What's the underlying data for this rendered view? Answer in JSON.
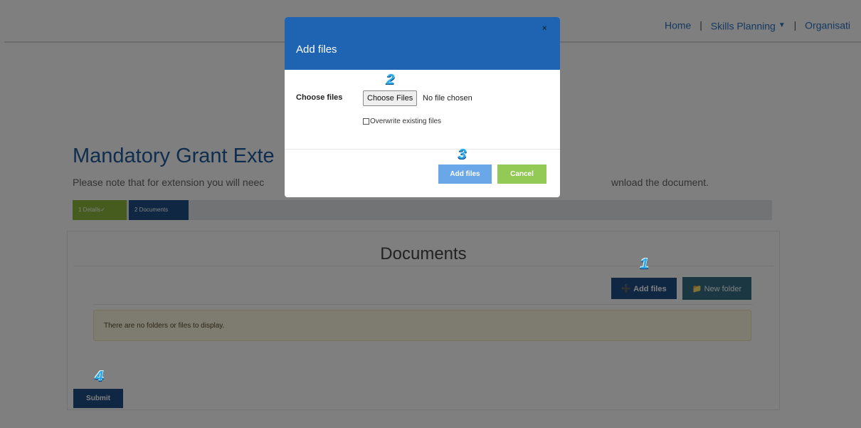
{
  "navbar": {
    "home": "Home",
    "skills_planning": "Skills Planning",
    "organisation": "Organisati",
    "separator": "|"
  },
  "page": {
    "title": "Mandatory Grant Exte",
    "note_start": "Please note that for extension you will neec",
    "note_end": "wnload the document."
  },
  "steps": [
    {
      "label": "1 Details✓",
      "state": "completed"
    },
    {
      "label": "2 Documents",
      "state": "active"
    }
  ],
  "documents": {
    "heading": "Documents",
    "add_files_label": "Add files",
    "new_folder_label": "New folder",
    "empty_message": "There are no folders or files to display.",
    "submit_label": "Submit"
  },
  "modal": {
    "title": "Add files",
    "close_glyph": "×",
    "choose_label": "Choose files",
    "choose_button": "Choose Files",
    "no_file": "No file chosen",
    "overwrite_label": "Overwrite existing files",
    "overwrite_checked": false,
    "add_button": "Add files",
    "cancel_button": "Cancel"
  },
  "callouts": [
    "1",
    "2",
    "3",
    "4"
  ],
  "colors": {
    "primary_dark": "#1f4f86",
    "modal_header": "#1f63b3",
    "success_green": "#8cb63c",
    "cancel_green": "#93c955",
    "alert_bg": "#fcf8e3",
    "callout": "#29a8e8"
  }
}
